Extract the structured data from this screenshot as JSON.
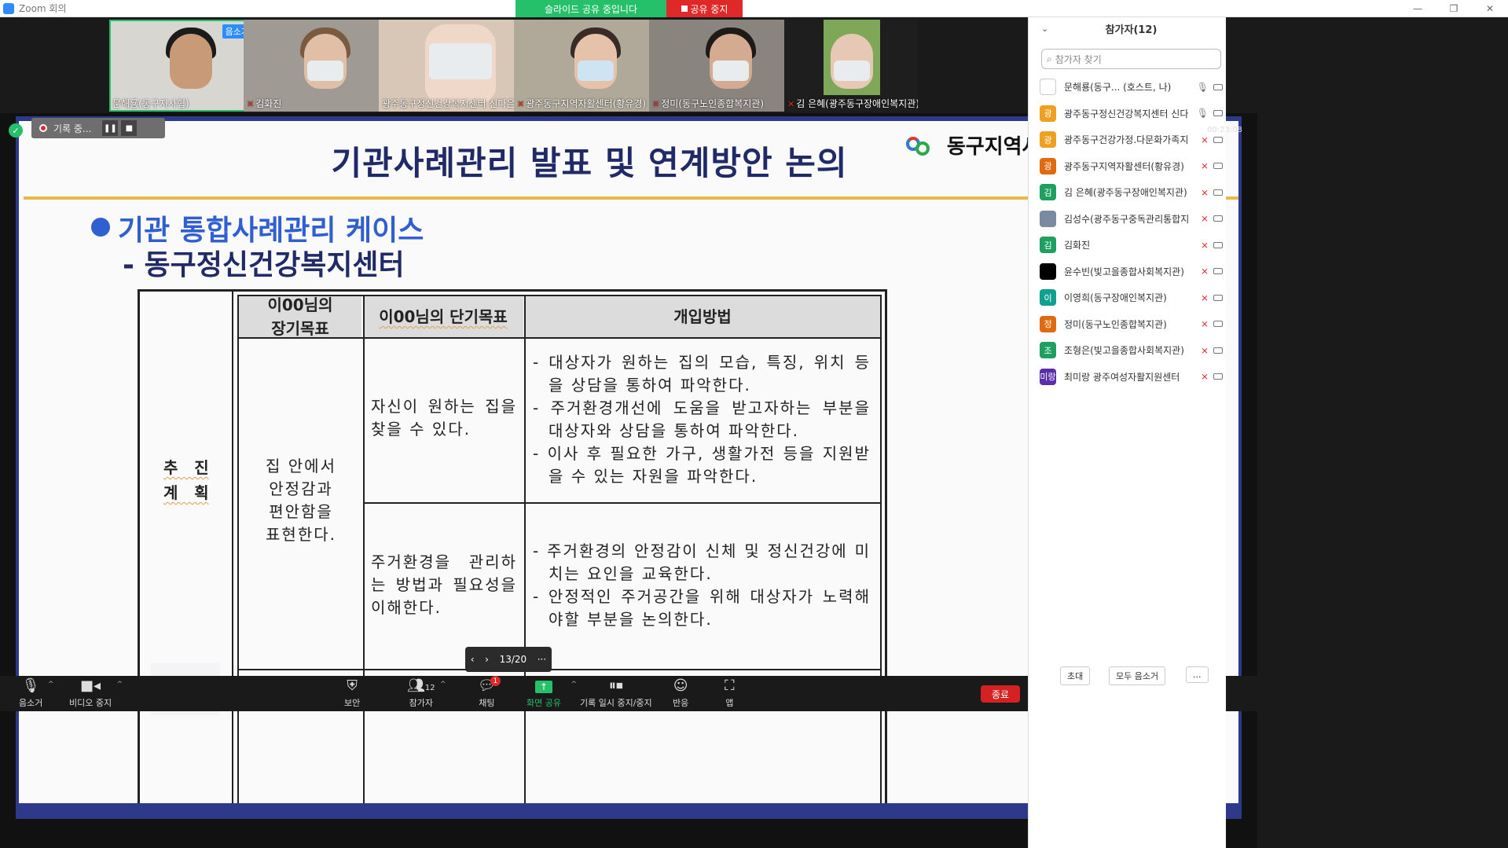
{
  "window": {
    "title": "Zoom 회의"
  },
  "share_banner": {
    "sharing_text": "슬라이드 공유 중입니다",
    "stop_label": "공유 중지"
  },
  "gallery": {
    "tiles": [
      {
        "name": "문해룡(동구지사협)",
        "badge": "음소거",
        "muted": false
      },
      {
        "name": "김화진",
        "muted": true
      },
      {
        "name": "광주동구정신건강복지센터 신다은",
        "muted": false
      },
      {
        "name": "광주동구지역자활센터(황유경)",
        "muted": true
      },
      {
        "name": "정미(동구노인종합복지관)",
        "muted": true
      },
      {
        "name": "김 은혜(광주동구장애인복지관)",
        "muted": true
      }
    ]
  },
  "recording": {
    "label": "기록 중..."
  },
  "timer": "00:23:08",
  "slide": {
    "title": "기관사례관리 발표 및 연계방안 논의",
    "org_name": "동구지역사회보장협의체",
    "bullet": "기관 통합사례관리 케이스",
    "subtitle": "- 동구정신건강복지센터",
    "table": {
      "side_label_1": "추   진",
      "side_label_2": "계   획",
      "headers": [
        "이00님의\n장기목표",
        "이00님의 단기목표",
        "개입방법"
      ],
      "long_goal": "집 안에서\n안정감과\n편안함을\n표현한다.",
      "short_goal_1": "자신이 원하는 집을 찾을 수 있다.",
      "short_goal_2": "주거환경을 관리하는 방법과 필요성을 이해한다.",
      "method_1": [
        "- 대상자가 원하는 집의 모습, 특징, 위치 등을 상담을 통하여 파악한다.",
        "- 주거환경개선에 도움을 받고자하는 부분을 대상자와 상담을 통하여 파악한다.",
        "- 이사 후 필요한 가구, 생활가전 등을 지원받을 수 있는 자원을 파악한다."
      ],
      "method_2": [
        "- 주거환경의 안정감이 신체 및 정신건강에 미치는 요인을 교육한다.",
        "- 안정적인 주거공간을 위해 대상자가 노력해야할 부분을 논의한다."
      ]
    }
  },
  "slide_nav": {
    "page": "13/20"
  },
  "toolbar": {
    "mute": "음소거",
    "video": "비디오 중지",
    "security": "보안",
    "participants": "참가자",
    "participants_count": "12",
    "chat": "채팅",
    "chat_badge": "1",
    "share": "화면 공유",
    "record": "기록 일시 중지/중지",
    "reactions": "반응",
    "apps": "앱",
    "end": "종료"
  },
  "panel": {
    "title": "참가자(12)",
    "search_placeholder": "참가자 찾기",
    "participants": [
      {
        "initial": "",
        "color": "#ffffff",
        "name": "문해룡(동구...  (호스트, 나)",
        "muted": false,
        "logo": true
      },
      {
        "initial": "광",
        "color": "#f0a020",
        "name": "광주동구정신건강복지센터 신다은",
        "muted": false
      },
      {
        "initial": "광",
        "color": "#f0a020",
        "name": "광주동구건강가정.다문화가족지...",
        "muted": true
      },
      {
        "initial": "광",
        "color": "#e06a10",
        "name": "광주동구지역자활센터(황유경)",
        "muted": true
      },
      {
        "initial": "김",
        "color": "#20a060",
        "name": "김 은혜(광주동구장애인복지관)",
        "muted": true
      },
      {
        "initial": "",
        "color": "#7a8aa0",
        "name": "김성수(광주동구중독관리통합지...",
        "muted": true,
        "photo": true
      },
      {
        "initial": "김",
        "color": "#20a060",
        "name": "김화진",
        "muted": true
      },
      {
        "initial": "",
        "color": "#000000",
        "name": "윤수빈(빛고을종합사회복지관)",
        "muted": true
      },
      {
        "initial": "이",
        "color": "#10a090",
        "name": "이영희(동구장애인복지관)",
        "muted": true
      },
      {
        "initial": "정",
        "color": "#e06a10",
        "name": "정미(동구노인종합복지관)",
        "muted": true
      },
      {
        "initial": "조",
        "color": "#20a060",
        "name": "조형은(빛고을종합사회복지관)",
        "muted": true
      },
      {
        "initial": "미랑",
        "color": "#5a2ea8",
        "name": "최미랑 광주여성자활지원센터",
        "muted": true
      }
    ],
    "invite": "초대",
    "mute_all": "모두 음소거",
    "more": "..."
  }
}
